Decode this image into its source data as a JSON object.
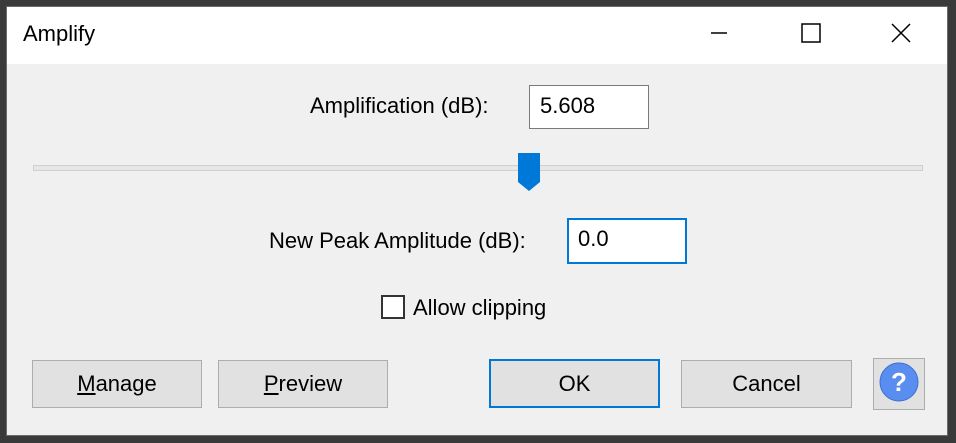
{
  "window": {
    "title": "Amplify",
    "minimize_icon": "minimize-icon",
    "maximize_icon": "maximize-icon",
    "close_icon": "close-icon"
  },
  "amplification": {
    "label": "Amplification (dB):",
    "value": "5.608"
  },
  "slider": {
    "level_fraction": 0.557,
    "accent_color": "#0078d7"
  },
  "peak": {
    "label": "New Peak Amplitude (dB):",
    "value": "0.0"
  },
  "clipping": {
    "label": "Allow clipping",
    "checked": false
  },
  "buttons": {
    "manage": {
      "mnemonic": "M",
      "rest": "anage"
    },
    "preview": {
      "mnemonic": "P",
      "rest": "review"
    },
    "ok": "OK",
    "cancel": "Cancel",
    "help_icon": "help-icon",
    "help_glyph": "?"
  }
}
